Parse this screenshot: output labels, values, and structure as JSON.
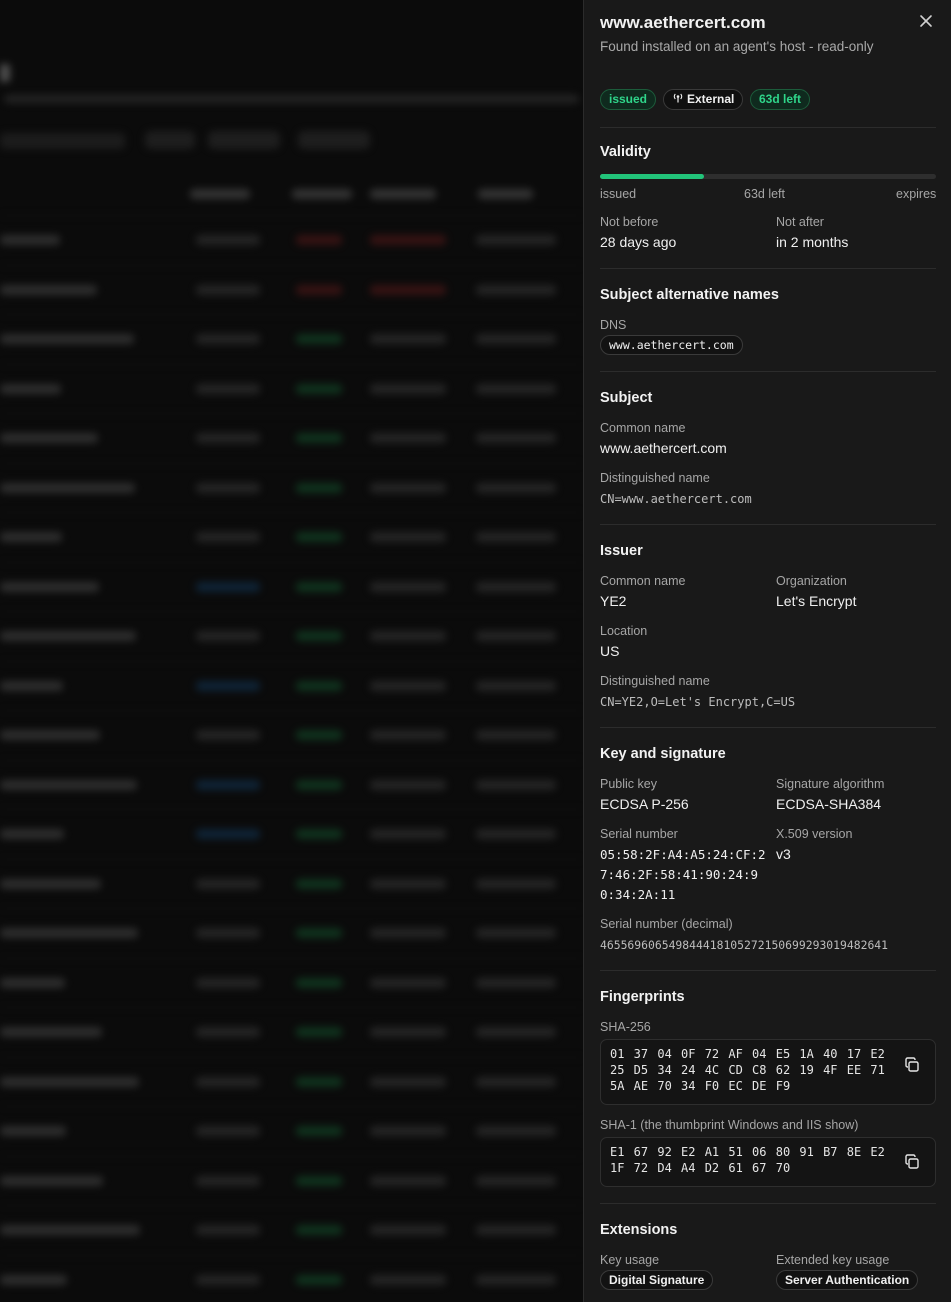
{
  "panel": {
    "title": "www.aethercert.com",
    "subtitle": "Found installed on an agent's host - read-only",
    "close_icon": "close-icon",
    "badges": {
      "status": "issued",
      "source": "External",
      "source_icon": "broadcast-icon",
      "remaining": "63d left"
    },
    "validity": {
      "heading": "Validity",
      "progress_fraction": 0.31,
      "start_label": "issued",
      "mid_label": "63d left",
      "end_label": "expires",
      "not_before_label": "Not before",
      "not_before": "28 days ago",
      "not_after_label": "Not after",
      "not_after": "in 2 months"
    },
    "san": {
      "heading": "Subject alternative names",
      "dns_label": "DNS",
      "dns": [
        "www.aethercert.com"
      ]
    },
    "subject": {
      "heading": "Subject",
      "cn_label": "Common name",
      "cn": "www.aethercert.com",
      "dn_label": "Distinguished name",
      "dn": "CN=www.aethercert.com"
    },
    "issuer": {
      "heading": "Issuer",
      "cn_label": "Common name",
      "cn": "YE2",
      "org_label": "Organization",
      "org": "Let's Encrypt",
      "loc_label": "Location",
      "loc": "US",
      "dn_label": "Distinguished name",
      "dn": "CN=YE2,O=Let's Encrypt,C=US"
    },
    "key": {
      "heading": "Key and signature",
      "pubkey_label": "Public key",
      "pubkey": "ECDSA P-256",
      "sigalg_label": "Signature algorithm",
      "sigalg": "ECDSA-SHA384",
      "serial_label": "Serial number",
      "serial_lines": [
        "05:58:2F:A4:A5:24:CF:2",
        "7:46:2F:58:41:90:24:9",
        "0:34:2A:11"
      ],
      "version_label": "X.509 version",
      "version": "v3",
      "serial_dec_label": "Serial number (decimal)",
      "serial_dec": "465569606549844418105272150699293019482641"
    },
    "fingerprints": {
      "heading": "Fingerprints",
      "sha256_label": "SHA-256",
      "sha256": "01 37 04 0F 72 AF 04 E5 1A 40 17 E2 25 D5 34 24 4C CD C8 62 19 4F EE 71 5A AE 70 34 F0 EC DE F9",
      "sha1_label": "SHA-1 (the thumbprint Windows and IIS show)",
      "sha1": "E1 67 92 E2 A1 51 06 80 91 B7 8E E2 1F 72 D4 A4 D2 61 67 70",
      "copy_icon": "copy-icon"
    },
    "extensions": {
      "heading": "Extensions",
      "key_usage_label": "Key usage",
      "key_usage": "Digital Signature",
      "eku_label": "Extended key usage",
      "eku": "Server Authentication"
    }
  },
  "colors": {
    "accent_green": "#22c47a",
    "panel_bg": "#191919",
    "page_bg": "#0b0b0b"
  }
}
